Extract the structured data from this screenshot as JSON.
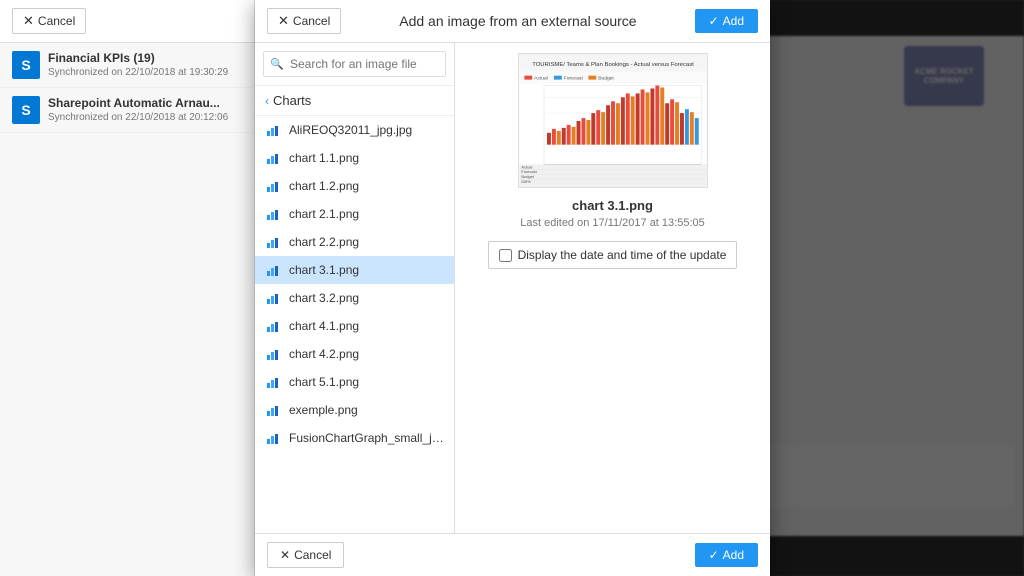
{
  "modal": {
    "title": "Add an image from an external source",
    "cancel_label": "Cancel",
    "add_label": "Add",
    "search_placeholder": "Search for an image file"
  },
  "sources": [
    {
      "name": "Financial KPIs (19)",
      "sync": "Synchronized on 22/10/2018 at 19:30:29",
      "icon": "SP"
    },
    {
      "name": "Sharepoint Automatic Arnau...",
      "sync": "Synchronized on 22/10/2018 at 20:12:06",
      "icon": "SP"
    }
  ],
  "folder": {
    "back_label": "Charts"
  },
  "files": [
    {
      "name": "AliREOQ32011_jpg.jpg"
    },
    {
      "name": "chart 1.1.png"
    },
    {
      "name": "chart 1.2.png"
    },
    {
      "name": "chart 2.1.png"
    },
    {
      "name": "chart 2.2.png"
    },
    {
      "name": "chart 3.1.png",
      "selected": true
    },
    {
      "name": "chart 3.2.png"
    },
    {
      "name": "chart 4.1.png"
    },
    {
      "name": "chart 4.2.png"
    },
    {
      "name": "chart 5.1.png"
    },
    {
      "name": "exemple.png"
    },
    {
      "name": "FusionChartGraph_small_jpg.jpg"
    }
  ],
  "preview": {
    "filename": "chart 3.1.png",
    "date_label": "Last edited on 17/11/2017 at 13:55:05",
    "checkbox_label": "Display the date and time of the update"
  }
}
